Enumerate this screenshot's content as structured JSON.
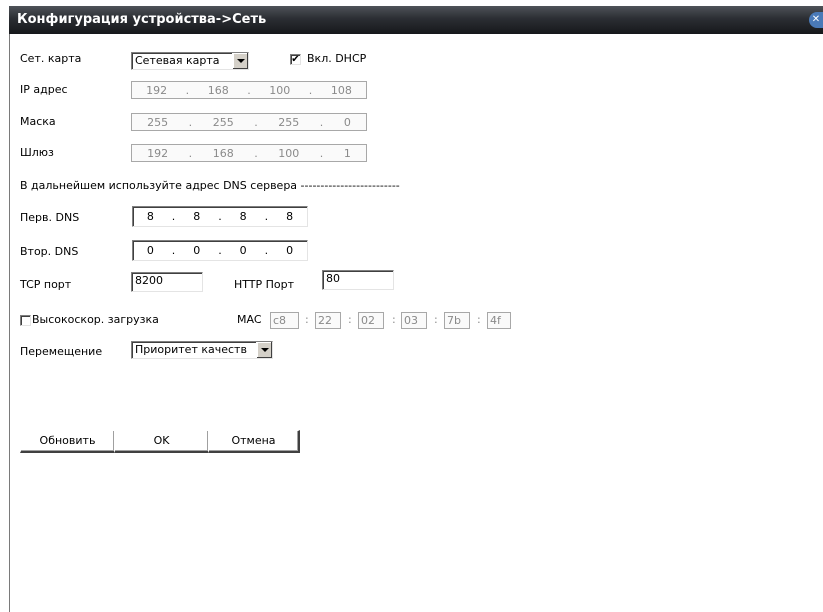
{
  "window": {
    "title": "Конфигурация устройства->Сеть"
  },
  "labels": {
    "net_card": "Сет. карта",
    "ip": "IP адрес",
    "mask": "Маска",
    "gateway": "Шлюз",
    "dns_note": "В дальнейшем используйте адрес DNS сервера -------------------------",
    "dns1": "Перв. DNS",
    "dns2": "Втор. DNS",
    "tcp": "TCP порт",
    "http": "HTTP Порт",
    "hs_download": "Высокоскор. загрузка",
    "mac": "MAC",
    "transfer": "Перемещение"
  },
  "net_card_select": {
    "value": "Сетевая карта"
  },
  "dhcp": {
    "label": "Вкл. DHCP",
    "checked": true,
    "mark": "✔"
  },
  "ip": [
    "192",
    "168",
    "100",
    "108"
  ],
  "mask": [
    "255",
    "255",
    "255",
    "0"
  ],
  "gateway": [
    "192",
    "168",
    "100",
    "1"
  ],
  "dns1": [
    "8",
    "8",
    "8",
    "8"
  ],
  "dns2": [
    "0",
    "0",
    "0",
    "0"
  ],
  "tcp_port": "8200",
  "http_port": "80",
  "hs_download_checked": false,
  "mac": [
    "c8",
    "22",
    "02",
    "03",
    "7b",
    "4f"
  ],
  "mac_sep": ":",
  "dot": ".",
  "transfer_select": {
    "value": "Приоритет качеств"
  },
  "buttons": {
    "refresh": "Обновить",
    "ok": "OK",
    "cancel": "Отмена"
  },
  "icons": {
    "close": "close-icon"
  }
}
